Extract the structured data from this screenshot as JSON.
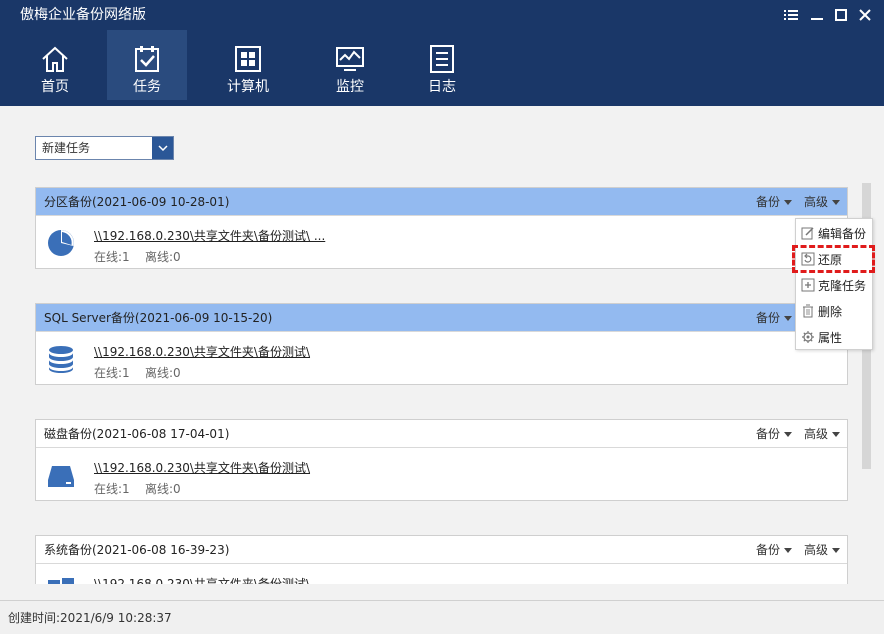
{
  "app": {
    "title": "傲梅企业备份网络版"
  },
  "window_controls": {
    "menu_icon": "menu-icon",
    "minimize_icon": "minimize-icon",
    "maximize_icon": "maximize-icon",
    "close_icon": "close-icon"
  },
  "nav": [
    {
      "label": "首页",
      "icon": "home-icon"
    },
    {
      "label": "任务",
      "icon": "tasks-icon",
      "active": true
    },
    {
      "label": "计算机",
      "icon": "computer-icon"
    },
    {
      "label": "监控",
      "icon": "monitor-icon"
    },
    {
      "label": "日志",
      "icon": "log-icon"
    }
  ],
  "new_task": {
    "label": "新建任务"
  },
  "tasks": [
    {
      "name": "分区备份(2021-06-09 10-28-01)",
      "path": "\\\\192.168.0.230\\共享文件夹\\备份测试\\ ...",
      "online": "在线:1",
      "offline": "离线:0",
      "icon": "partition-icon",
      "selected": true
    },
    {
      "name": "SQL Server备份(2021-06-09 10-15-20)",
      "path": "\\\\192.168.0.230\\共享文件夹\\备份测试\\",
      "online": "在线:1",
      "offline": "离线:0",
      "icon": "database-icon",
      "selected": true
    },
    {
      "name": "磁盘备份(2021-06-08 17-04-01)",
      "path": "\\\\192.168.0.230\\共享文件夹\\备份测试\\",
      "online": "在线:1",
      "offline": "离线:0",
      "icon": "disk-icon"
    },
    {
      "name": "系统备份(2021-06-08 16-39-23)",
      "path": "\\\\192.168.0.230\\共享文件夹\\备份测试\\",
      "online": "",
      "offline": "",
      "icon": "windows-icon"
    }
  ],
  "task_actions": {
    "backup": "备份",
    "advanced": "高级"
  },
  "context_menu": [
    {
      "label": "编辑备份",
      "icon": "edit-icon"
    },
    {
      "label": "还原",
      "icon": "restore-icon",
      "highlighted": true
    },
    {
      "label": "克隆任务",
      "icon": "clone-icon"
    },
    {
      "label": "删除",
      "icon": "delete-icon"
    },
    {
      "label": "属性",
      "icon": "settings-icon"
    }
  ],
  "status": {
    "text": "创建时间:2021/6/9 10:28:37"
  },
  "colors": {
    "header": "#1a3768",
    "selected_row": "#93baf0",
    "accent": "#2b5797",
    "highlight_border": "#e01b1b",
    "icon_blue": "#3a6fb8"
  }
}
